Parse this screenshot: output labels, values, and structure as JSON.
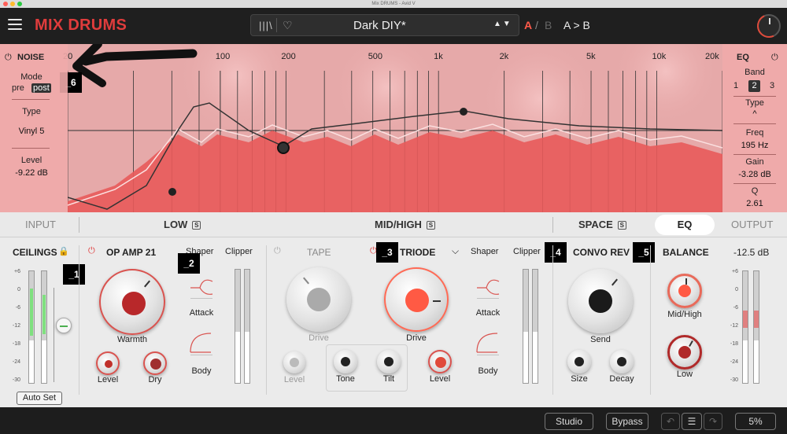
{
  "window": {
    "title": "Mix DRUMS - Avid V"
  },
  "header": {
    "brand": "MIX DRUMS",
    "preset_name": "Dark DIY*",
    "ab_a": "A",
    "ab_slash": "/",
    "ab_b": "B",
    "ab_copy": "A > B",
    "library_icon": "library-icon",
    "heart_icon": "heart-icon",
    "arrows": "▲▼"
  },
  "noise": {
    "title": "NOISE",
    "mode_label": "Mode",
    "mode_pre": "pre",
    "mode_post": "post",
    "type_label": "Type",
    "type_value": "Vinyl 5",
    "level_label": "Level",
    "level_value": "-9.22 dB"
  },
  "eq_panel": {
    "title": "EQ",
    "band_label": "Band",
    "band_1": "1",
    "band_2": "2",
    "band_3": "3",
    "type_label": "Type",
    "type_glyph": "^",
    "freq_label": "Freq",
    "freq_value": "195 Hz",
    "gain_label": "Gain",
    "gain_value": "-3.28 dB",
    "q_label": "Q",
    "q_value": "2.61"
  },
  "freq_axis": [
    "20",
    "100",
    "200",
    "500",
    "1k",
    "2k",
    "5k",
    "10k",
    "20k"
  ],
  "tabs": {
    "input": "INPUT",
    "low": "LOW",
    "low_badge": "S",
    "midhigh": "MID/HIGH",
    "midhigh_badge": "S",
    "space": "SPACE",
    "space_badge": "S",
    "eq": "EQ",
    "output": "OUTPUT"
  },
  "modules": {
    "ceilings": "CEILINGS",
    "opamp": "OP AMP 21",
    "warmth": "Warmth",
    "level": "Level",
    "dry": "Dry",
    "shaper": "Shaper",
    "attack": "Attack",
    "body": "Body",
    "clipper": "Clipper",
    "tape": "TAPE",
    "drive": "Drive",
    "triode": "TRIODE",
    "tone": "Tone",
    "tilt": "Tilt",
    "convo_rev": "CONVO REV",
    "send": "Send",
    "size": "Size",
    "decay": "Decay",
    "balance": "BALANCE",
    "midhigh_knob": "Mid/High",
    "low_knob": "Low",
    "output_value": "-12.5 dB",
    "auto_set": "Auto Set",
    "meter_scale": [
      "+6",
      "0",
      "-6",
      "-12",
      "-18",
      "-24",
      "-30"
    ]
  },
  "markers": {
    "m1": "_1",
    "m2": "_2",
    "m3": "_3",
    "m4": "_4",
    "m5": "_5",
    "m6": "_6"
  },
  "footer": {
    "studio": "Studio",
    "bypass": "Bypass",
    "zoom": "5%"
  },
  "colors": {
    "accent": "#e03c3c",
    "spectrum_fill": "#e85a5a",
    "panel_bg": "#ebebeb"
  }
}
